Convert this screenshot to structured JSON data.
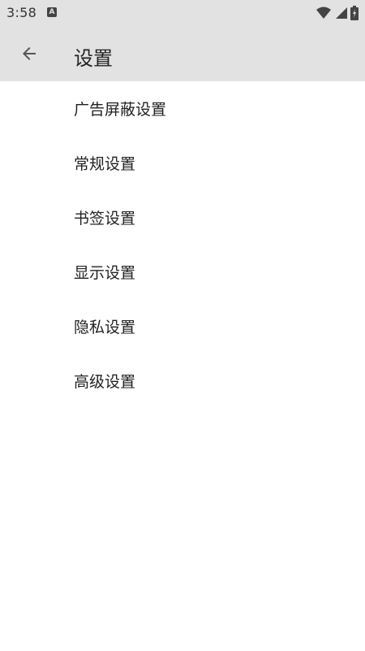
{
  "status_bar": {
    "time": "3:58",
    "notification_badge": "A",
    "icons": [
      "wifi-icon",
      "signal-icon",
      "battery-charging-icon"
    ]
  },
  "app_bar": {
    "back_icon": "arrow-back-icon",
    "title": "设置"
  },
  "settings_list": {
    "items": [
      {
        "label": "广告屏蔽设置"
      },
      {
        "label": "常规设置"
      },
      {
        "label": "书签设置"
      },
      {
        "label": "显示设置"
      },
      {
        "label": "隐私设置"
      },
      {
        "label": "高级设置"
      }
    ]
  },
  "colors": {
    "bar_background": "#e2e2e2",
    "page_background": "#ffffff",
    "text": "#222222"
  }
}
